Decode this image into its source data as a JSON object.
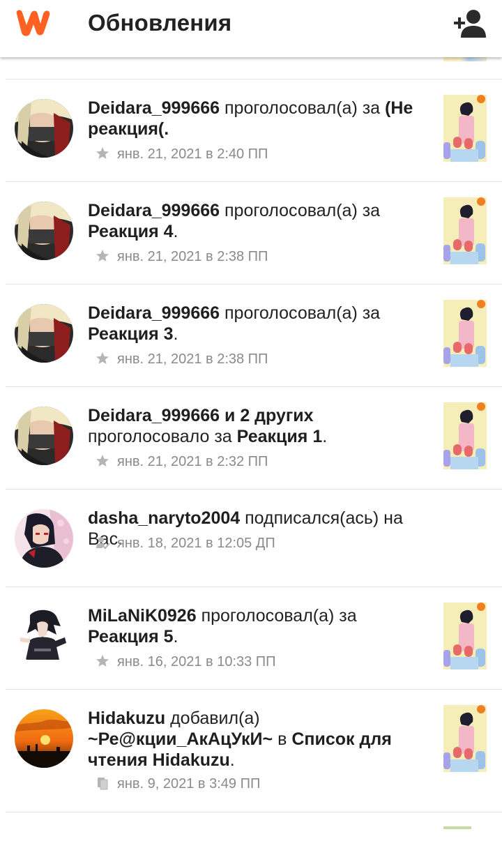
{
  "header": {
    "title": "Обновления",
    "logo_icon": "wattpad-logo-icon",
    "add_user_icon": "add-user-icon",
    "accent_color": "#ff6122"
  },
  "feed": {
    "items": [
      {
        "user": "Deidara_999666",
        "action": "проголосовал(а) за",
        "target": "(Не реакция(.",
        "meta_icon": "star-icon",
        "time": "янв. 21, 2021 в 2:40 ПП"
      },
      {
        "user": "Deidara_999666",
        "action": "проголосовал(а) за",
        "target": "Реакция 4",
        "tail": ".",
        "meta_icon": "star-icon",
        "time": "янв. 21, 2021 в 2:38 ПП"
      },
      {
        "user": "Deidara_999666",
        "action": "проголосовал(а) за",
        "target": "Реакция 3",
        "tail": ".",
        "meta_icon": "star-icon",
        "time": "янв. 21, 2021 в 2:38 ПП"
      },
      {
        "user": "Deidara_999666",
        "connector": "и",
        "others": "2 других",
        "action": "проголосовало за",
        "target": "Реакция 1",
        "tail": ".",
        "meta_icon": "star-icon",
        "time": "янв. 21, 2021 в 2:32 ПП"
      },
      {
        "user": "dasha_naryto2004",
        "action": "подписался(ась) на Вас.",
        "meta_icon": "follow-icon",
        "time": "янв. 18, 2021 в 12:05 ДП"
      },
      {
        "user": "MiLaNiK0926",
        "action": "проголосовал(а) за",
        "target": "Реакция 5",
        "tail": ".",
        "meta_icon": "star-icon",
        "time": "янв. 16, 2021 в 10:33 ПП"
      },
      {
        "user": "Hidakuzu",
        "action": "добавил(а)",
        "target": "~Ре@кции_АкАцУкИ~",
        "connector": "в",
        "list": "Список для чтения Hidakuzu",
        "tail": ".",
        "meta_icon": "library-icon",
        "time": "янв. 9, 2021 в 3:49 ПП"
      }
    ]
  }
}
